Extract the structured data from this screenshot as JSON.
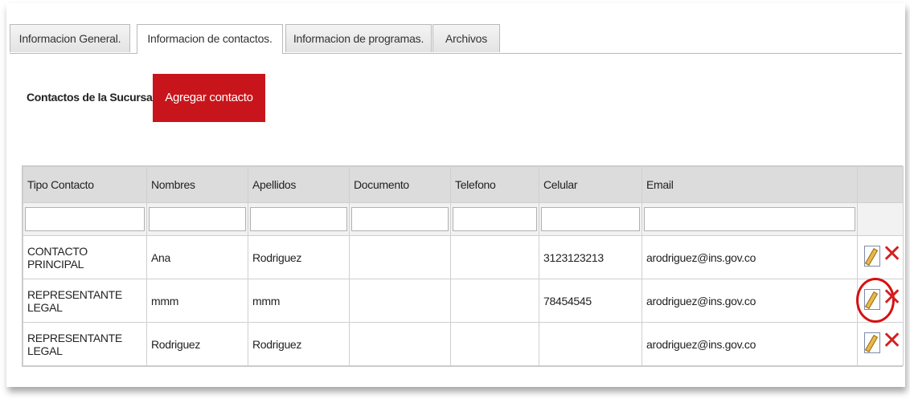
{
  "tabs": [
    {
      "label": "Informacion General."
    },
    {
      "label": "Informacion de contactos."
    },
    {
      "label": "Informacion de programas."
    },
    {
      "label": "Archivos"
    }
  ],
  "section": {
    "title": "Contactos de la Sucursal",
    "add_button": "Agregar contacto"
  },
  "table": {
    "headers": [
      "Tipo Contacto",
      "Nombres",
      "Apellidos",
      "Documento",
      "Telefono",
      "Celular",
      "Email",
      ""
    ],
    "rows": [
      {
        "tipo": "CONTACTO PRINCIPAL",
        "nombres": "Ana",
        "apellidos": "Rodriguez",
        "documento": "",
        "telefono": "",
        "celular": "3123123213",
        "email": "arodriguez@ins.gov.co"
      },
      {
        "tipo": "REPRESENTANTE LEGAL",
        "nombres": "mmm",
        "apellidos": "mmm",
        "documento": "",
        "telefono": "",
        "celular": "78454545",
        "email": "arodriguez@ins.gov.co"
      },
      {
        "tipo": "REPRESENTANTE LEGAL",
        "nombres": "Rodriguez",
        "apellidos": "Rodriguez",
        "documento": "",
        "telefono": "",
        "celular": "",
        "email": "arodriguez@ins.gov.co"
      }
    ]
  },
  "icons": {
    "edit": "pencil-edit-icon",
    "delete": "red-x-delete-icon"
  },
  "colors": {
    "accent": "#c8151b",
    "highlight_circle": "#d61010"
  }
}
